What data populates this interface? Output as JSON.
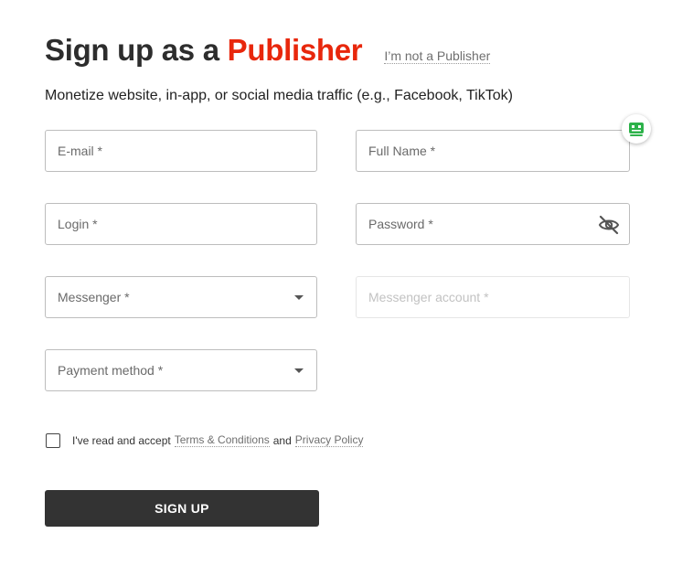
{
  "header": {
    "title_prefix": "Sign up as a",
    "title_accent": "Publisher",
    "not_publisher_link": "I’m not a Publisher",
    "subtitle": "Monetize website, in-app, or social media traffic (e.g., Facebook, TikTok)"
  },
  "form": {
    "email": "E-mail *",
    "full_name": "Full Name *",
    "login": "Login *",
    "password": "Password *",
    "messenger": "Messenger *",
    "messenger_account": "Messenger account *",
    "payment_method": "Payment method *"
  },
  "consent": {
    "prefix": "I've read and accept",
    "terms": "Terms & Conditions",
    "and": "and",
    "privacy": "Privacy Policy",
    "checked": false
  },
  "submit": {
    "label": "SIGN UP"
  },
  "colors": {
    "accent": "#e8270c",
    "button_bg": "#333333",
    "widget_green": "#2db24a"
  },
  "icons": {
    "password_toggle": "eye-slash-icon",
    "chat": "chat-bot-icon",
    "select": "caret-down-icon"
  }
}
